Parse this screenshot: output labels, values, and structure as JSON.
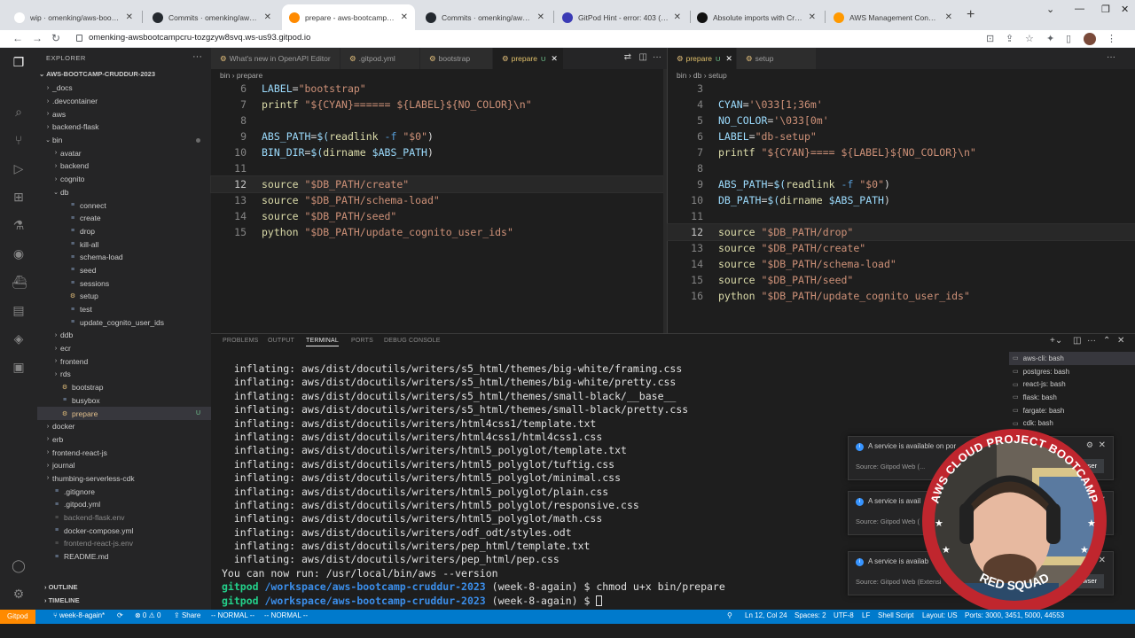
{
  "browser": {
    "tabs": [
      {
        "title": "wip · omenking/aws-bootcamp",
        "icon_color": "#ffffff",
        "active": false
      },
      {
        "title": "Commits · omenking/aws-bootcamp",
        "icon_color": "#24292f",
        "active": false
      },
      {
        "title": "prepare - aws-bootcamp-cruddur",
        "icon_color": "#ff8a00",
        "active": true
      },
      {
        "title": "Commits · omenking/aws-bootcamp",
        "icon_color": "#24292f",
        "active": false
      },
      {
        "title": "GitPod Hint - error: 403 (Permi",
        "icon_color": "#3b3bb5",
        "active": false
      },
      {
        "title": "Absolute imports with Create R",
        "icon_color": "#111111",
        "active": false
      },
      {
        "title": "AWS Management Console",
        "icon_color": "#ff9900",
        "active": false
      }
    ],
    "url": "omenking-awsbootcampcru-tozgzyw8svq.ws-us93.gitpod.io"
  },
  "explorer": {
    "header": "EXPLORER",
    "root": "AWS-BOOTCAMP-CRUDDUR-2023",
    "items": [
      {
        "label": "_docs",
        "depth": 1,
        "kind": "folder",
        "open": false
      },
      {
        "label": ".devcontainer",
        "depth": 1,
        "kind": "folder",
        "open": false
      },
      {
        "label": "aws",
        "depth": 1,
        "kind": "folder",
        "open": false
      },
      {
        "label": "backend-flask",
        "depth": 1,
        "kind": "folder",
        "open": false
      },
      {
        "label": "bin",
        "depth": 1,
        "kind": "folder",
        "open": true,
        "dot": true
      },
      {
        "label": "avatar",
        "depth": 2,
        "kind": "folder",
        "open": false
      },
      {
        "label": "backend",
        "depth": 2,
        "kind": "folder",
        "open": false
      },
      {
        "label": "cognito",
        "depth": 2,
        "kind": "folder",
        "open": false
      },
      {
        "label": "db",
        "depth": 2,
        "kind": "folder",
        "open": true
      },
      {
        "label": "connect",
        "depth": 3,
        "kind": "file"
      },
      {
        "label": "create",
        "depth": 3,
        "kind": "file"
      },
      {
        "label": "drop",
        "depth": 3,
        "kind": "file"
      },
      {
        "label": "kill-all",
        "depth": 3,
        "kind": "file"
      },
      {
        "label": "schema-load",
        "depth": 3,
        "kind": "file"
      },
      {
        "label": "seed",
        "depth": 3,
        "kind": "file"
      },
      {
        "label": "sessions",
        "depth": 3,
        "kind": "file"
      },
      {
        "label": "setup",
        "depth": 3,
        "kind": "file",
        "mod": true
      },
      {
        "label": "test",
        "depth": 3,
        "kind": "file"
      },
      {
        "label": "update_cognito_user_ids",
        "depth": 3,
        "kind": "file"
      },
      {
        "label": "ddb",
        "depth": 2,
        "kind": "folder",
        "open": false
      },
      {
        "label": "ecr",
        "depth": 2,
        "kind": "folder",
        "open": false
      },
      {
        "label": "frontend",
        "depth": 2,
        "kind": "folder",
        "open": false
      },
      {
        "label": "rds",
        "depth": 2,
        "kind": "folder",
        "open": false
      },
      {
        "label": "bootstrap",
        "depth": 2,
        "kind": "file",
        "mod": true
      },
      {
        "label": "busybox",
        "depth": 2,
        "kind": "file"
      },
      {
        "label": "prepare",
        "depth": 2,
        "kind": "file",
        "mod": true,
        "selected": true,
        "badge": "U"
      },
      {
        "label": "docker",
        "depth": 1,
        "kind": "folder",
        "open": false
      },
      {
        "label": "erb",
        "depth": 1,
        "kind": "folder",
        "open": false
      },
      {
        "label": "frontend-react-js",
        "depth": 1,
        "kind": "folder",
        "open": false
      },
      {
        "label": "journal",
        "depth": 1,
        "kind": "folder",
        "open": false
      },
      {
        "label": "thumbing-serverless-cdk",
        "depth": 1,
        "kind": "folder",
        "open": false
      },
      {
        "label": ".gitignore",
        "depth": 1,
        "kind": "file"
      },
      {
        "label": ".gitpod.yml",
        "depth": 1,
        "kind": "file"
      },
      {
        "label": "backend-flask.env",
        "depth": 1,
        "kind": "file",
        "dim": true
      },
      {
        "label": "docker-compose.yml",
        "depth": 1,
        "kind": "file"
      },
      {
        "label": "frontend-react-js.env",
        "depth": 1,
        "kind": "file",
        "dim": true
      },
      {
        "label": "README.md",
        "depth": 1,
        "kind": "file"
      }
    ],
    "outline": "OUTLINE",
    "timeline": "TIMELINE"
  },
  "editor_left": {
    "tabs": [
      "What's new in OpenAPI Editor",
      ".gitpod.yml",
      "bootstrap",
      "prepare"
    ],
    "active_badge": "U",
    "breadcrumb": [
      "bin",
      "prepare"
    ],
    "lines": [
      {
        "n": "6",
        "text": "LABEL=\"bootstrap\""
      },
      {
        "n": "7",
        "text": "printf \"${CYAN}====== ${LABEL}${NO_COLOR}\\n\""
      },
      {
        "n": "8",
        "text": ""
      },
      {
        "n": "9",
        "text": "ABS_PATH=$(readlink -f \"$0\")"
      },
      {
        "n": "10",
        "text": "BIN_DIR=$(dirname $ABS_PATH)"
      },
      {
        "n": "11",
        "text": ""
      },
      {
        "n": "12",
        "text": "source \"$DB_PATH/create\""
      },
      {
        "n": "13",
        "text": "source \"$DB_PATH/schema-load\""
      },
      {
        "n": "14",
        "text": "source \"$DB_PATH/seed\""
      },
      {
        "n": "15",
        "text": "python \"$DB_PATH/update_cognito_user_ids\""
      }
    ]
  },
  "editor_right": {
    "tabs": [
      "prepare",
      "setup"
    ],
    "active_badge": "U",
    "breadcrumb": [
      "bin",
      "db",
      "setup"
    ],
    "lines": [
      {
        "n": "3",
        "text": ""
      },
      {
        "n": "4",
        "text": "CYAN='\\033[1;36m'"
      },
      {
        "n": "5",
        "text": "NO_COLOR='\\033[0m'"
      },
      {
        "n": "6",
        "text": "LABEL=\"db-setup\""
      },
      {
        "n": "7",
        "text": "printf \"${CYAN}==== ${LABEL}${NO_COLOR}\\n\""
      },
      {
        "n": "8",
        "text": ""
      },
      {
        "n": "9",
        "text": "ABS_PATH=$(readlink -f \"$0\")"
      },
      {
        "n": "10",
        "text": "DB_PATH=$(dirname $ABS_PATH)"
      },
      {
        "n": "11",
        "text": ""
      },
      {
        "n": "12",
        "text": "source \"$DB_PATH/drop\""
      },
      {
        "n": "13",
        "text": "source \"$DB_PATH/create\""
      },
      {
        "n": "14",
        "text": "source \"$DB_PATH/schema-load\""
      },
      {
        "n": "15",
        "text": "source \"$DB_PATH/seed\""
      },
      {
        "n": "16",
        "text": "python \"$DB_PATH/update_cognito_user_ids\""
      }
    ]
  },
  "panel": {
    "tabs": [
      "PROBLEMS",
      "OUTPUT",
      "TERMINAL",
      "PORTS",
      "DEBUG CONSOLE"
    ],
    "active_tab": "TERMINAL",
    "terminal_lines": [
      "  inflating: aws/dist/docutils/writers/s5_html/themes/big-white/framing.css",
      "  inflating: aws/dist/docutils/writers/s5_html/themes/big-white/pretty.css",
      "  inflating: aws/dist/docutils/writers/s5_html/themes/small-black/__base__",
      "  inflating: aws/dist/docutils/writers/s5_html/themes/small-black/pretty.css",
      "  inflating: aws/dist/docutils/writers/html4css1/template.txt",
      "  inflating: aws/dist/docutils/writers/html4css1/html4css1.css",
      "  inflating: aws/dist/docutils/writers/html5_polyglot/template.txt",
      "  inflating: aws/dist/docutils/writers/html5_polyglot/tuftig.css",
      "  inflating: aws/dist/docutils/writers/html5_polyglot/minimal.css",
      "  inflating: aws/dist/docutils/writers/html5_polyglot/plain.css",
      "  inflating: aws/dist/docutils/writers/html5_polyglot/responsive.css",
      "  inflating: aws/dist/docutils/writers/html5_polyglot/math.css",
      "  inflating: aws/dist/docutils/writers/odf_odt/styles.odt",
      "  inflating: aws/dist/docutils/writers/pep_html/template.txt",
      "  inflating: aws/dist/docutils/writers/pep_html/pep.css",
      "You can now run: /usr/local/bin/aws --version"
    ],
    "prompts": [
      {
        "user": "gitpod",
        "path": "/workspace/aws-bootcamp-cruddur-2023",
        "branch": "(week-8-again) $",
        "cmd": " chmod u+x bin/prepare"
      },
      {
        "user": "gitpod",
        "path": "/workspace/aws-bootcamp-cruddur-2023",
        "branch": "(week-8-again) $",
        "cmd": " "
      }
    ],
    "terminals": [
      "aws-cli: bash",
      "postgres: bash",
      "react-js: bash",
      "flask: bash",
      "fargate: bash",
      "cdk: bash"
    ]
  },
  "notifications": [
    {
      "title": "A service is available on por",
      "source": "Source: Gitpod Web (...",
      "button": "owser"
    },
    {
      "title": "A service is avail",
      "source": "Source: Gitpod Web (",
      "button": ""
    },
    {
      "title": "A service is availab",
      "source": "Source: Gitpod Web (Extensi",
      "button": "owser"
    }
  ],
  "badge": {
    "top_text": "AWS CLOUD PROJECT BOOTCAMP",
    "bottom_text": "RED SQUAD",
    "ring_color": "#c0262e"
  },
  "statusbar": {
    "gitpod": "Gitpod",
    "branch": "week-8-again*",
    "problems": "⊗ 0 ⚠ 0",
    "share": "Share",
    "mode1": "-- NORMAL --",
    "mode2": "-- NORMAL --",
    "position": "Ln 12, Col 24",
    "spaces": "Spaces: 2",
    "encoding": "UTF-8",
    "eol": "LF",
    "language": "Shell Script",
    "layout": "Layout: US",
    "ports": "Ports: 3000, 3451, 5000, 44553"
  }
}
